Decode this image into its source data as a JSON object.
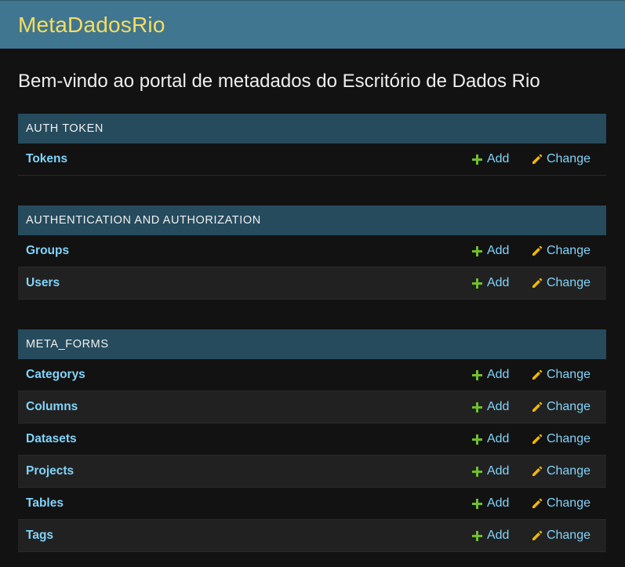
{
  "header": {
    "brand": "MetaDadosRio"
  },
  "page": {
    "title": "Bem-vindo ao portal de metadados do Escritório de Dados Rio"
  },
  "actions": {
    "add_label": "Add",
    "change_label": "Change"
  },
  "colors": {
    "header_bg": "#417690",
    "brand": "#f5dd5d",
    "caption_bg": "#264b5d",
    "link": "#81d4fa",
    "add_icon": "#70bf2b",
    "change_icon": "#efb80b"
  },
  "modules": [
    {
      "caption": "AUTH TOKEN",
      "models": [
        "Tokens"
      ]
    },
    {
      "caption": "AUTHENTICATION AND AUTHORIZATION",
      "models": [
        "Groups",
        "Users"
      ]
    },
    {
      "caption": "META_FORMS",
      "models": [
        "Categorys",
        "Columns",
        "Datasets",
        "Projects",
        "Tables",
        "Tags"
      ]
    }
  ]
}
